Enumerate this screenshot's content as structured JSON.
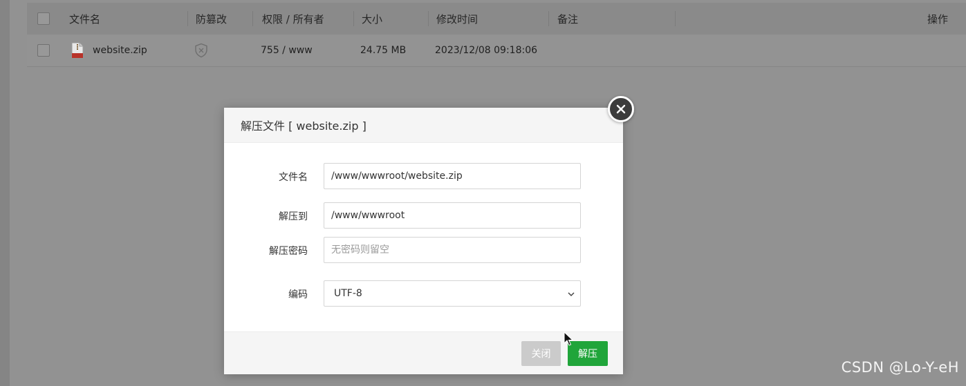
{
  "table": {
    "columns": {
      "name": "文件名",
      "tamper": "防篡改",
      "permission": "权限 / 所有者",
      "size": "大小",
      "modified": "修改时间",
      "note": "备注",
      "actions": "操作"
    },
    "rows": [
      {
        "name": "website.zip",
        "icon": "zip-file-icon",
        "tamper_icon": "shield-off-icon",
        "permission": "755 / www",
        "size": "24.75 MB",
        "modified": "2023/12/08 09:18:06",
        "note": ""
      }
    ]
  },
  "modal": {
    "title": "解压文件 [ website.zip ]",
    "fields": {
      "filename_label": "文件名",
      "filename_value": "/www/wwwroot/website.zip",
      "target_label": "解压到",
      "target_value": "/www/wwwroot",
      "password_label": "解压密码",
      "password_placeholder": "无密码则留空",
      "encoding_label": "编码",
      "encoding_value": "UTF-8"
    },
    "buttons": {
      "close": "关闭",
      "extract": "解压"
    }
  },
  "watermark": "CSDN @Lo-Y-eH",
  "colors": {
    "accent_green": "#20a53a",
    "button_disabled": "#cbcbcb",
    "overlay": "#8f8f8f"
  }
}
